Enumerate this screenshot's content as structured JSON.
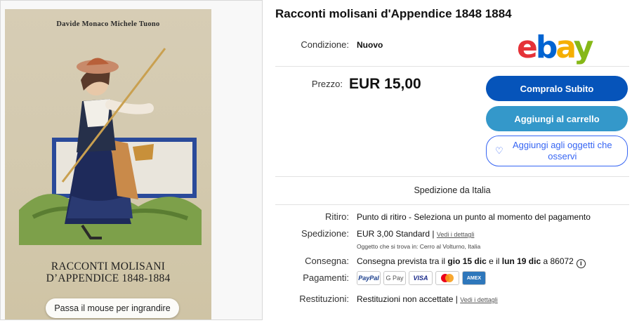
{
  "cover": {
    "authors": "Davide Monaco  Michele Tuono",
    "title_line1": "RACCONTI MOLISANI",
    "title_line2": "D’APPENDICE 1848-1884",
    "hover_hint": "Passa il mouse per ingrandire"
  },
  "product": {
    "title": "Racconti molisani d'Appendice 1848 1884",
    "condition_label": "Condizione:",
    "condition_value": "Nuovo",
    "price_label": "Prezzo:",
    "price_value": "EUR 15,00"
  },
  "brand": {
    "e": "e",
    "b": "b",
    "a": "a",
    "y": "y"
  },
  "actions": {
    "buy_now": "Compralo Subito",
    "add_to_cart": "Aggiungi al carrello",
    "watch": "Aggiungi agli oggetti che osservi"
  },
  "shipping": {
    "from": "Spedizione da Italia",
    "pickup_label": "Ritiro:",
    "pickup_value": "Punto di ritiro - Seleziona un punto al momento del pagamento",
    "shipping_label": "Spedizione:",
    "shipping_value": "EUR 3,00 Standard | ",
    "details_link": "Vedi i dettagli",
    "item_location": "Oggetto che si trova in: Cerro al Volturno, Italia",
    "delivery_label": "Consegna:",
    "delivery_prefix": "Consegna prevista tra il ",
    "delivery_from": "gio 15 dic",
    "delivery_mid": " e il ",
    "delivery_to": "lun 19 dic",
    "delivery_suffix": " a 86072",
    "payments_label": "Pagamenti:",
    "payments": [
      "PayPal",
      "G Pay",
      "VISA",
      "Mastercard",
      "AMEX"
    ],
    "returns_label": "Restituzioni:",
    "returns_value": "Restituzioni non accettate | ",
    "returns_link": "Vedi i dettagli"
  },
  "icons": {
    "info": "info-icon",
    "heart": "heart-icon"
  },
  "colors": {
    "buy_button": "#0654ba",
    "cart_button": "#3498ca",
    "watch_border": "#3665f3"
  }
}
